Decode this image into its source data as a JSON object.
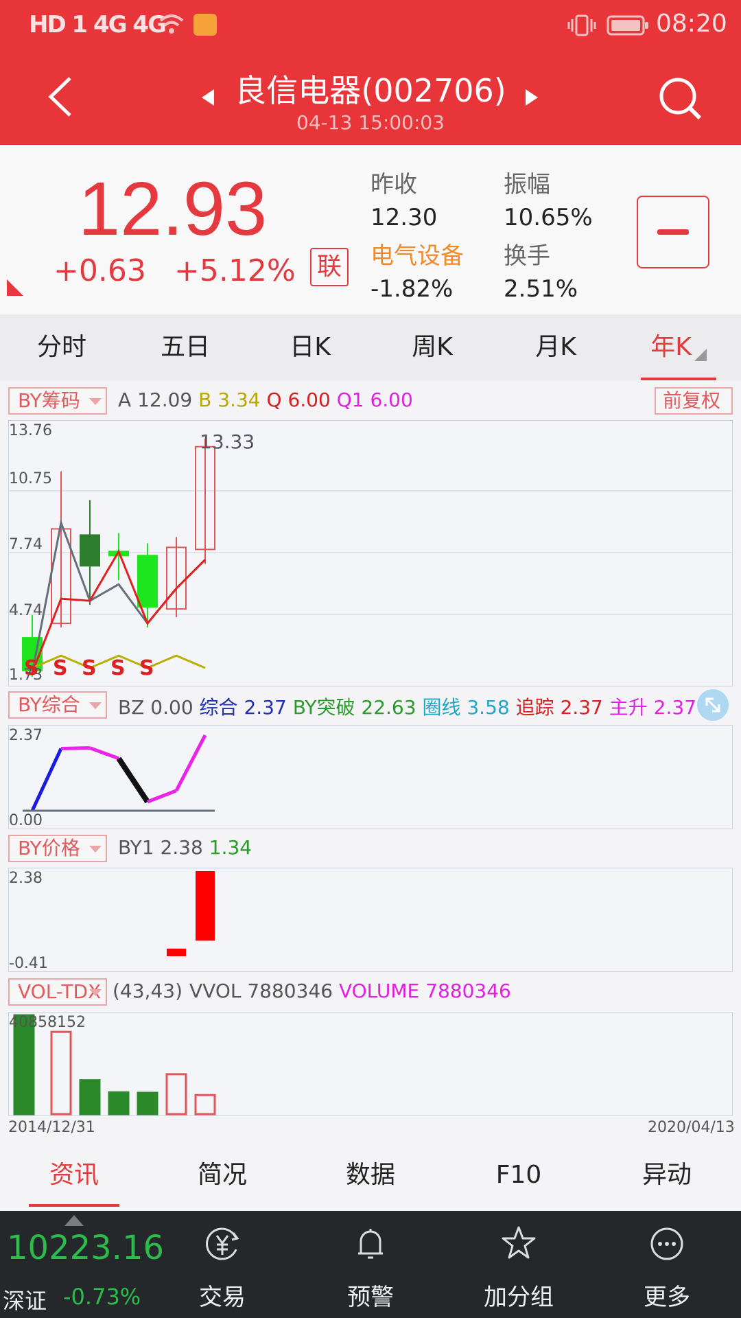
{
  "status_bar": {
    "left_icons": "HD 1 4G 4G",
    "time": "08:20"
  },
  "header": {
    "title": "良信电器(002706)",
    "datetime": "04-13 15:00:03"
  },
  "quote": {
    "price": "12.93",
    "change": "+0.63",
    "change_pct": "+5.12%",
    "lian": "联",
    "prev_close_label": "昨收",
    "prev_close": "12.30",
    "amplitude_label": "振幅",
    "amplitude": "10.65%",
    "sector_label": "电气设备",
    "sector_change": "-1.82%",
    "turnover_label": "换手",
    "turnover": "2.51%"
  },
  "period_tabs": [
    "分时",
    "五日",
    "日K",
    "周K",
    "月K",
    "年K"
  ],
  "main_panel": {
    "indicator": "BY筹码",
    "legend": [
      {
        "k": "A",
        "v": "12.09",
        "kc": "#555",
        "vc": "#555"
      },
      {
        "k": "B",
        "v": "3.34",
        "kc": "#b8a800",
        "vc": "#b8a800"
      },
      {
        "k": "Q",
        "v": "6.00",
        "kc": "#d62020",
        "vc": "#d62020"
      },
      {
        "k": "Q1",
        "v": "6.00",
        "kc": "#e020e0",
        "vc": "#e020e0"
      }
    ],
    "adjust": "前复权",
    "y_ticks": [
      "13.76",
      "10.75",
      "7.74",
      "4.74",
      "1.73"
    ],
    "high_label": "13.33",
    "s_marks": [
      "S",
      "S",
      "S",
      "S",
      "S"
    ]
  },
  "chart_data": [
    {
      "type": "candlestick",
      "name": "年K",
      "x": [
        "2014",
        "2015",
        "2016",
        "2017",
        "2018",
        "2019",
        "2020"
      ],
      "open": [
        3.6,
        4.3,
        8.6,
        7.8,
        7.6,
        5.0,
        7.9
      ],
      "close": [
        2.0,
        8.9,
        7.1,
        7.6,
        5.1,
        8.0,
        12.9
      ],
      "high": [
        4.7,
        11.7,
        10.3,
        8.7,
        8.2,
        8.5,
        13.3
      ],
      "low": [
        1.7,
        4.1,
        5.2,
        6.4,
        4.1,
        4.6,
        7.2
      ],
      "ylim": [
        1.73,
        13.76
      ]
    },
    {
      "type": "line",
      "name": "BY综合",
      "values": [
        0,
        1.95,
        1.97,
        1.64,
        0.28,
        0.63,
        2.37
      ],
      "ylim": [
        0,
        2.37
      ]
    },
    {
      "type": "bar",
      "name": "BY价格",
      "values": [
        -0.41,
        2.38
      ],
      "ylim": [
        -0.41,
        2.38
      ]
    },
    {
      "type": "bar",
      "name": "VOL-TDX",
      "values": [
        40858152,
        34000000,
        14000000,
        9000000,
        8800000,
        16500000,
        7880346
      ],
      "ylim": [
        0,
        40858152
      ]
    }
  ],
  "sub1": {
    "indicator": "BY综合",
    "legend": [
      {
        "k": "BZ",
        "v": "0.00",
        "kc": "#555",
        "vc": "#555"
      },
      {
        "k": "综合",
        "v": "2.37",
        "kc": "#2030b0",
        "vc": "#2030b0"
      },
      {
        "k": "BY突破",
        "v": "22.63",
        "kc": "#2a9a2a",
        "vc": "#2a9a2a"
      },
      {
        "k": "圈线",
        "v": "3.58",
        "kc": "#1ea8c8",
        "vc": "#1ea8c8"
      },
      {
        "k": "追踪",
        "v": "2.37",
        "kc": "#d62020",
        "vc": "#d62020"
      },
      {
        "k": "主升",
        "v": "2.37",
        "kc": "#e020e0",
        "vc": "#e020e0"
      }
    ],
    "y_top": "2.37",
    "y_bottom": "0.00"
  },
  "sub2": {
    "indicator": "BY价格",
    "legend": [
      {
        "k": "BY1",
        "v": "2.38",
        "kc": "#555",
        "vc": "#555"
      },
      {
        "k": "",
        "v": "1.34",
        "kc": "#2a9a2a",
        "vc": "#2a9a2a"
      }
    ],
    "y_top": "2.38",
    "y_bottom": "-0.41"
  },
  "vol": {
    "indicator": "VOL-TDX",
    "params": "(43,43)",
    "legend": [
      {
        "k": "VVOL",
        "v": "7880346",
        "kc": "#555",
        "vc": "#555"
      },
      {
        "k": "VOLUME",
        "v": "7880346",
        "kc": "#e020e0",
        "vc": "#e020e0"
      }
    ],
    "y_top": "40858152",
    "x_start": "2014/12/31",
    "x_end": "2020/04/13"
  },
  "info_tabs": [
    "资讯",
    "简况",
    "数据",
    "F10",
    "异动"
  ],
  "bottom_nav": {
    "index_value": "10223.16",
    "index_name": "深证",
    "index_change": "-0.73%",
    "items": [
      "交易",
      "预警",
      "加分组",
      "更多"
    ]
  },
  "colors": {
    "brand_red": "#e8353a",
    "up_red": "#e43a3f",
    "down_green": "#2a9a2a",
    "nav_bg": "#24282b"
  }
}
